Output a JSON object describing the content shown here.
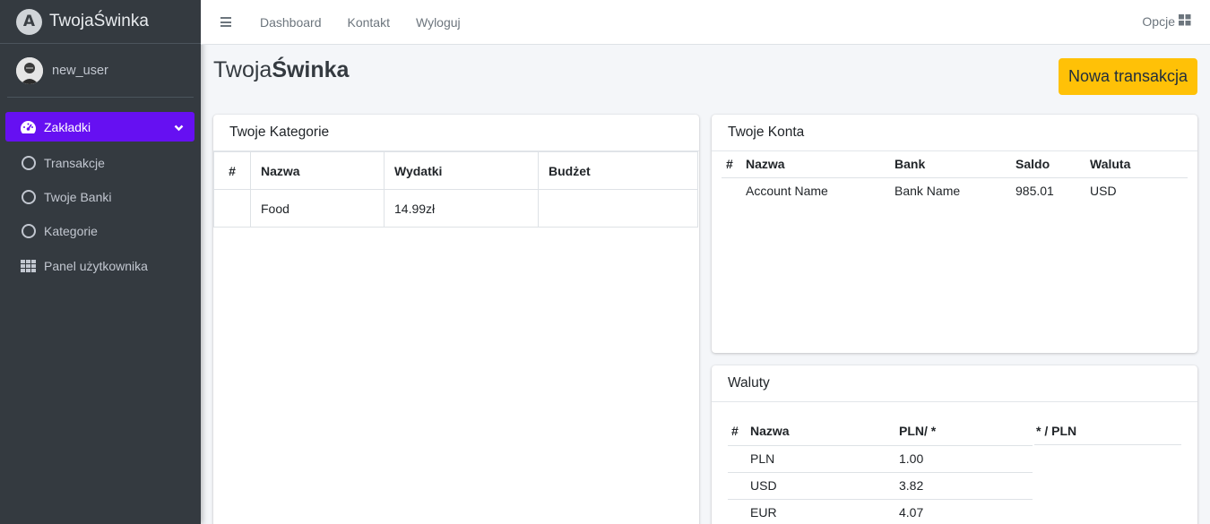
{
  "brand": {
    "name_prefix": "Twoja",
    "name_suffix": "Świnka",
    "logo_letter": "A"
  },
  "user": {
    "name": "new_user"
  },
  "sidebar": {
    "items": [
      {
        "label": "Zakładki",
        "icon": "dashboard-icon",
        "active": true
      },
      {
        "label": "Transakcje",
        "icon": "circle-icon"
      },
      {
        "label": "Twoje Banki",
        "icon": "circle-icon"
      },
      {
        "label": "Kategorie",
        "icon": "circle-icon"
      },
      {
        "label": "Panel użytkownika",
        "icon": "grid-icon"
      }
    ]
  },
  "navbar": {
    "links": [
      "Dashboard",
      "Kontakt",
      "Wyloguj"
    ],
    "options_label": "Opcje"
  },
  "page": {
    "title_prefix": "Twoja",
    "title_suffix": "Świnka",
    "new_transaction_label": "Nowa transakcja"
  },
  "categories": {
    "title": "Twoje Kategorie",
    "headers": [
      "#",
      "Nazwa",
      "Wydatki",
      "Budżet"
    ],
    "rows": [
      {
        "num": "",
        "name": "Food",
        "spent": "14.99zł",
        "budget": ""
      }
    ]
  },
  "accounts": {
    "title": "Twoje Konta",
    "headers": [
      "#",
      "Nazwa",
      "Bank",
      "Saldo",
      "Waluta"
    ],
    "rows": [
      {
        "num": "",
        "name": "Account Name",
        "bank": "Bank Name",
        "balance": "985.01",
        "currency": "USD"
      }
    ]
  },
  "currencies": {
    "title": "Waluty",
    "headers": [
      "#",
      "Nazwa",
      "PLN/ *",
      "* / PLN"
    ],
    "rows": [
      {
        "name": "PLN",
        "rate": "1.00"
      },
      {
        "name": "USD",
        "rate": "3.82"
      },
      {
        "name": "EUR",
        "rate": "4.07"
      }
    ]
  },
  "colors": {
    "sidebar_bg": "#343a40",
    "active_item": "#6610f2",
    "primary_button": "#ffc107"
  }
}
